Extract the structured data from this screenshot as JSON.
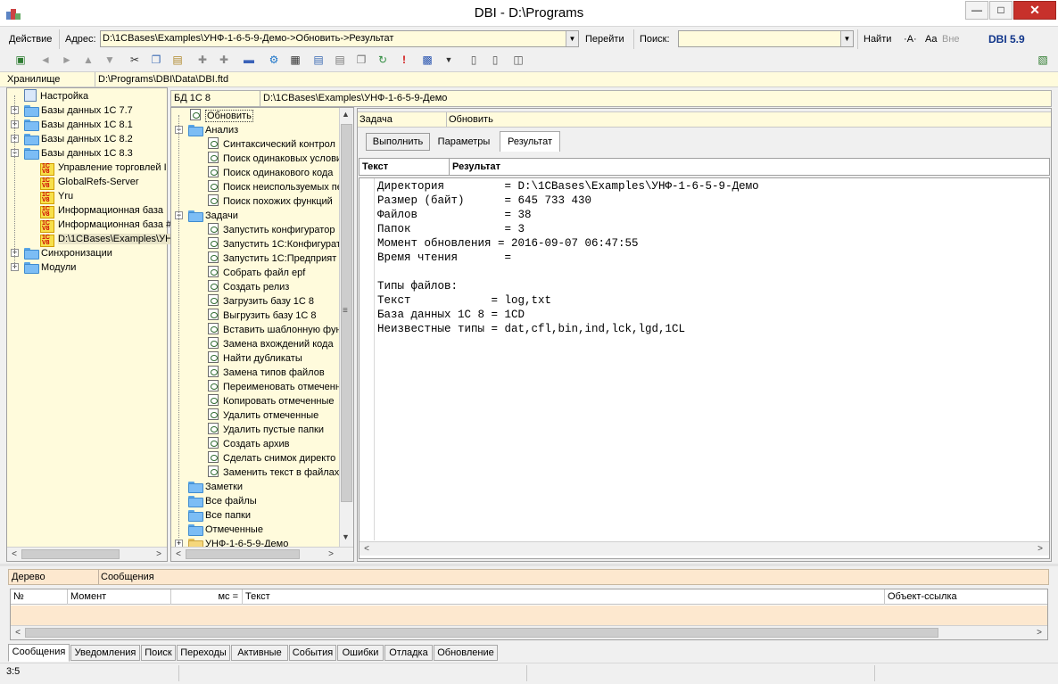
{
  "window": {
    "title": "DBI - D:\\Programs"
  },
  "addressbar": {
    "action_label": "Действие",
    "address_label": "Адрес:",
    "address_value": "D:\\1CBases\\Examples\\УНФ-1-6-5-9-Демо->Обновить->Результат",
    "go_label": "Перейти",
    "search_label": "Поиск:",
    "search_value": "",
    "find_label": "Найти",
    "font_a": "·A·",
    "case_aa": "Aa",
    "outside": "Вне",
    "version": "DBI 5.9"
  },
  "storage": {
    "label": "Хранилище",
    "path": "D:\\Programs\\DBI\\Data\\DBI.ftd"
  },
  "left_tree": {
    "items": [
      {
        "label": "Настройка"
      },
      {
        "label": "Базы данных 1С 7.7"
      },
      {
        "label": "Базы данных 1С 8.1"
      },
      {
        "label": "Базы данных 1С 8.2"
      },
      {
        "label": "Базы данных 1С 8.3"
      },
      {
        "label": "Управление торговлей I"
      },
      {
        "label": "GlobalRefs-Server"
      },
      {
        "label": "Yru"
      },
      {
        "label": "Информационная база"
      },
      {
        "label": "Информационная база #"
      },
      {
        "label": "D:\\1CBases\\Examples\\УН"
      },
      {
        "label": "Синхронизации"
      },
      {
        "label": "Модули"
      }
    ]
  },
  "middle": {
    "db_label": "БД 1С 8",
    "db_path": "D:\\1CBases\\Examples\\УНФ-1-6-5-9-Демо",
    "items": [
      {
        "label": "Обновить"
      },
      {
        "label": "Анализ"
      },
      {
        "label": "Синтаксический контрол"
      },
      {
        "label": "Поиск одинаковых услови"
      },
      {
        "label": "Поиск одинакового кода"
      },
      {
        "label": "Поиск неиспользуемых пе"
      },
      {
        "label": "Поиск похожих функций"
      },
      {
        "label": "Задачи"
      },
      {
        "label": "Запустить конфигуратор"
      },
      {
        "label": "Запустить 1С:Конфигурат"
      },
      {
        "label": "Запустить 1С:Предприят"
      },
      {
        "label": "Собрать файл epf"
      },
      {
        "label": "Создать релиз"
      },
      {
        "label": "Загрузить базу 1С 8"
      },
      {
        "label": "Выгрузить базу 1С 8"
      },
      {
        "label": "Вставить шаблонную фун"
      },
      {
        "label": "Замена вхождений кода"
      },
      {
        "label": "Найти дубликаты"
      },
      {
        "label": "Замена типов файлов"
      },
      {
        "label": "Переименовать отмеченн"
      },
      {
        "label": "Копировать отмеченные"
      },
      {
        "label": "Удалить отмеченные"
      },
      {
        "label": "Удалить пустые папки"
      },
      {
        "label": "Создать архив"
      },
      {
        "label": "Сделать снимок директо"
      },
      {
        "label": "Заменить текст в файлах"
      },
      {
        "label": "Заметки"
      },
      {
        "label": "Все файлы"
      },
      {
        "label": "Все папки"
      },
      {
        "label": "Отмеченные"
      },
      {
        "label": "УНФ-1-6-5-9-Демо"
      }
    ]
  },
  "right": {
    "task_label": "Задача",
    "task_value": "Обновить",
    "buttons": {
      "run": "Выполнить",
      "params": "Параметры",
      "result": "Результат"
    },
    "col_text": "Текст",
    "col_result": "Результат",
    "lines": [
      "Директория         = D:\\1CBases\\Examples\\УНФ-1-6-5-9-Демо",
      "Размер (байт)      = 645 733 430",
      "Файлов             = 38",
      "Папок              = 3",
      "Момент обновления = 2016-09-07 06:47:55",
      "Время чтения       =",
      "",
      "Типы файлов:",
      "Текст            = log,txt",
      "База данных 1С 8 = 1CD",
      "Неизвестные типы = dat,cfl,bin,ind,lck,lgd,1CL"
    ]
  },
  "bottom": {
    "tree_label": "Дерево",
    "messages_label": "Сообщения",
    "columns": [
      "№",
      "Момент",
      "мс =",
      "Текст",
      "Объект-ссылка"
    ],
    "tabs": [
      "Сообщения",
      "Уведомления",
      "Поиск",
      "Переходы",
      "Активные",
      "События",
      "Ошибки",
      "Отладка",
      "Обновление"
    ]
  },
  "status": {
    "position": "3:5"
  }
}
